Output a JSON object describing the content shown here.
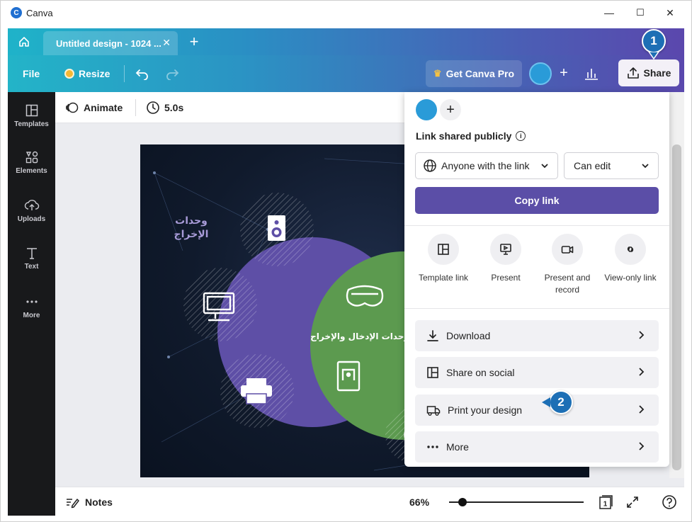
{
  "window": {
    "title": "Canva",
    "controls": {
      "minimize": "—",
      "maximize": "☐",
      "close": "✕"
    }
  },
  "tabs": {
    "doc_title": "Untitled design - 1024 ...",
    "close_glyph": "✕",
    "new_tab_glyph": "+"
  },
  "toolbar": {
    "file": "File",
    "resize": "Resize",
    "get_pro": "Get Canva Pro",
    "share": "Share",
    "plus_glyph": "+"
  },
  "sidebar": {
    "items": [
      {
        "label": "Templates",
        "icon": "templates-icon"
      },
      {
        "label": "Elements",
        "icon": "elements-icon"
      },
      {
        "label": "Uploads",
        "icon": "uploads-icon"
      },
      {
        "label": "Text",
        "icon": "text-icon"
      },
      {
        "label": "More",
        "icon": "more-icon"
      }
    ]
  },
  "editor": {
    "animate": "Animate",
    "duration": "5.0s"
  },
  "canvas": {
    "output_label_line1": "وحدات",
    "output_label_line2": "الإخراج",
    "center_label": "وحدات الإدخال والإخراج"
  },
  "statusbar": {
    "notes": "Notes",
    "zoom": "66%",
    "page_number": "1",
    "zoom_fraction": 0.1
  },
  "share_panel": {
    "link_shared": "Link shared publicly",
    "access": "Anyone with the link",
    "permission": "Can edit",
    "copy_link": "Copy link",
    "options": [
      {
        "label": "Template link",
        "icon": "template-link-icon"
      },
      {
        "label": "Present",
        "icon": "present-icon"
      },
      {
        "label": "Present and record",
        "icon": "present-record-icon"
      },
      {
        "label": "View-only link",
        "icon": "view-only-link-icon"
      }
    ],
    "rows": [
      {
        "label": "Download",
        "icon": "download-icon"
      },
      {
        "label": "Share on social",
        "icon": "share-social-icon"
      },
      {
        "label": "Print your design",
        "icon": "print-design-icon"
      },
      {
        "label": "More",
        "icon": "more-dots-icon"
      }
    ]
  },
  "callouts": {
    "one": "1",
    "two": "2"
  },
  "colors": {
    "accent": "#5b4ea7",
    "purple_circle": "#5e4fa6",
    "green_circle": "#5c9a4f",
    "badge": "#1d6fb5"
  }
}
